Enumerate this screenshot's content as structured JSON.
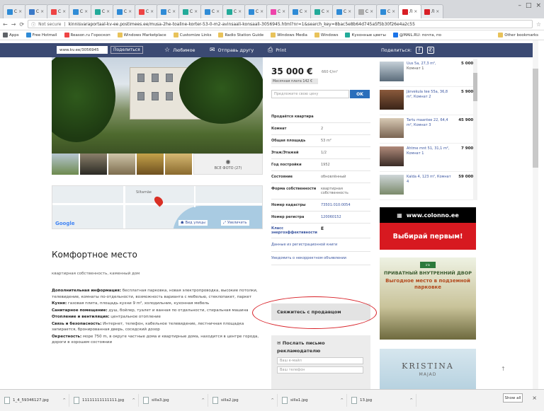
{
  "browser": {
    "tabs": [
      "C",
      "C",
      "C",
      "C",
      "C",
      "C",
      "C",
      "C",
      "C",
      "C",
      "C",
      "C",
      "C",
      "C",
      "C",
      "C",
      "C",
      "C",
      "Л",
      "Л"
    ],
    "url_secure": "Not secure",
    "url": "kinnisvaraportaal-kv-ee.postimees.ee/musa-2he-toaline-korter-53-0-m2-avinsaali-konsaali-3056945.html?nr=1&search_key=8bac5e8b64d745a5f5b30f26e4a2c55",
    "bookmarks": [
      "Apps",
      "Free Hotmail",
      "Reason.ru Гороскоп",
      "Windows Marketplace",
      "Customize Links",
      "Radio Station Guide",
      "Windows Media",
      "Windows",
      "Кухонные цветы",
      "@MAIL.RU: почта, по"
    ],
    "other_bookmarks": "Other bookmarks"
  },
  "topnav": {
    "id_value": "www.kv.ee/3056945",
    "share_btn": "Поделиться",
    "favorite": "Любимое",
    "send_friend": "Отправь другу",
    "print": "Print",
    "share_label": "Поделиться:"
  },
  "gallery": {
    "all_photos": "ВСЕ ФОТО (27)"
  },
  "map": {
    "label": "Siltamäe",
    "google": "Google",
    "street_view": "Вид улицы",
    "enlarge": "Увеличить"
  },
  "listing": {
    "title": "Комфортное место",
    "subtitle": "квартирная собственность, каменный дом",
    "description": [
      {
        "label": "Дополнительная информация:",
        "text": " бесплатная парковка, новая электропроводка, высокие потолки, телевидение, комнаты по-отдельности, возможность варианта с мебелью, стеклопакет, паркет"
      },
      {
        "label": "Кухня:",
        "text": " газовая плита, площадь кухни 9 m², холодильник, кухонная мебель"
      },
      {
        "label": "Санитарное помещение:",
        "text": " душ, бойлер, туалет и ванная по отдельности, стиральная машина"
      },
      {
        "label": "Отопление и вентиляция:",
        "text": " центральное отопление"
      },
      {
        "label": "Связь и безопасность:",
        "text": " Интернет, телефон, кабельное телевидение, лестничная площадка запирается, бронированная дверь, соседский дозор"
      },
      {
        "label": "Окрестность:",
        "text": " море 750 m, в округе частные дома и квартирные дома, находится в центре города, дороги в хорошем состоянии"
      }
    ]
  },
  "price": {
    "amount": "35 000 €",
    "per_m2": "660 €/m²",
    "monthly_fee": "Месячная плата 142 €",
    "offer_placeholder": "Предложите свою цену",
    "offer_btn": "OK"
  },
  "details": {
    "heading": "Продаётся квартира",
    "rows": [
      {
        "k": "Комнат",
        "v": "2"
      },
      {
        "k": "Общая площадь",
        "v": "53 m²"
      },
      {
        "k": "Этаж/Этажей",
        "v": "1/2"
      },
      {
        "k": "Год постройки",
        "v": "1952"
      },
      {
        "k": "Состояние",
        "v": "обновлённый"
      },
      {
        "k": "Форма собственности",
        "v": "квартирная собственность"
      },
      {
        "k": "Номер кадастры",
        "v": "73501:010:0054"
      },
      {
        "k": "Номер регистра",
        "v": "120060152"
      }
    ],
    "energy_label": "Класс энергоэффективности",
    "energy_value": "E",
    "link1": "Данные из регистрационной книги",
    "link2": "Уведомить о некорректном объявлении"
  },
  "contact": {
    "title": "Свяжитесь с продавцом",
    "letter_title": "Послать письмо рекламодателю",
    "email_placeholder": "Ваш e-майл",
    "phone_placeholder": "Ваш телефон"
  },
  "similar": [
    {
      "addr": "Uus 5a, 27,3 m²,",
      "rooms": "Комнат 1",
      "price": "5 000 €"
    },
    {
      "addr": "Järvekula tee 55a, 36,8 m², Комнат 2",
      "rooms": "",
      "price": "5 900 €"
    },
    {
      "addr": "Tartu maantee 22, 64,4 m², Комнат 3",
      "rooms": "",
      "price": "45 900 €"
    },
    {
      "addr": "Ahtme mnt 51, 31,1 m², Комнат 1",
      "rooms": "",
      "price": "7 900 €"
    },
    {
      "addr": "Kalda 4, 123 m², Комнат 4",
      "rooms": "",
      "price": "59 000 €"
    }
  ],
  "ads": {
    "ad1_top": "www.colonno.ee",
    "ad1_bottom": "Выбирай первым!",
    "ad2_logo": "iris",
    "ad2_t1": "ПРИВАТНЫЙ ВНУТРЕННИЙ ДВОР",
    "ad2_t2": "Выгодное место в подземной парковке",
    "ad3_k1": "KRISTINA",
    "ad3_k2": "MAJAD"
  },
  "downloads": {
    "files": [
      "1_4_59346127.jpg",
      "11111111111111.jpg",
      "silla3.jpg",
      "silla2.jpg",
      "silla1.jpg",
      "13.jpg"
    ],
    "show_all": "Show all"
  },
  "colors": {
    "nav_bg": "#3b4a73",
    "accent_blue": "#2a6ebb",
    "highlight_red": "#d81f26"
  }
}
